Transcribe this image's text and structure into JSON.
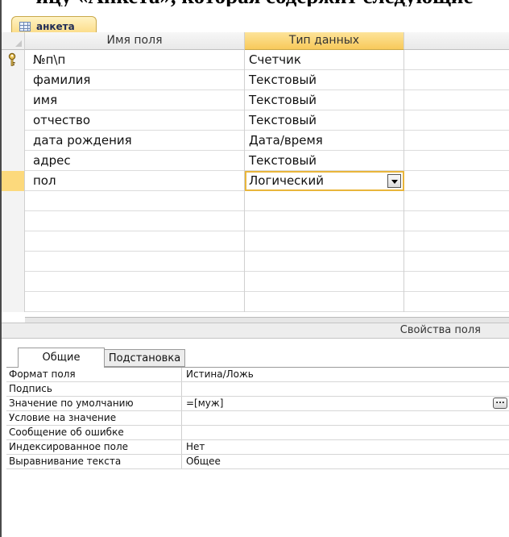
{
  "top_text": "ицу «Анкета», которая содержит следующие",
  "tab": {
    "label": "анкета",
    "icon": "table-icon"
  },
  "grid": {
    "columns": [
      "Имя поля",
      "Тип данных"
    ],
    "rows": [
      {
        "name": "№п\\п",
        "type": "Счетчик",
        "key": true
      },
      {
        "name": "фамилия",
        "type": "Текстовый"
      },
      {
        "name": "имя",
        "type": "Текстовый"
      },
      {
        "name": "отчество",
        "type": "Текстовый"
      },
      {
        "name": "дата рождения",
        "type": "Дата/время"
      },
      {
        "name": "адрес",
        "type": "Текстовый"
      },
      {
        "name": "пол",
        "type": "Логический",
        "active": true
      }
    ],
    "empty_rows": 6
  },
  "properties": {
    "title": "Свойства поля",
    "tabs": [
      "Общие",
      "Подстановка"
    ],
    "rows": [
      {
        "label": "Формат поля",
        "value": "Истина/Ложь"
      },
      {
        "label": "Подпись",
        "value": ""
      },
      {
        "label": "Значение по умолчанию",
        "value": "=[муж]",
        "builder": true
      },
      {
        "label": "Условие на значение",
        "value": ""
      },
      {
        "label": "Сообщение об ошибке",
        "value": ""
      },
      {
        "label": "Индексированное поле",
        "value": "Нет"
      },
      {
        "label": "Выравнивание текста",
        "value": "Общее"
      }
    ],
    "builder_label": "..."
  },
  "colors": {
    "accent": "#f8c95a",
    "active_border": "#e9b63b",
    "tab_text": "#1f2b55"
  }
}
